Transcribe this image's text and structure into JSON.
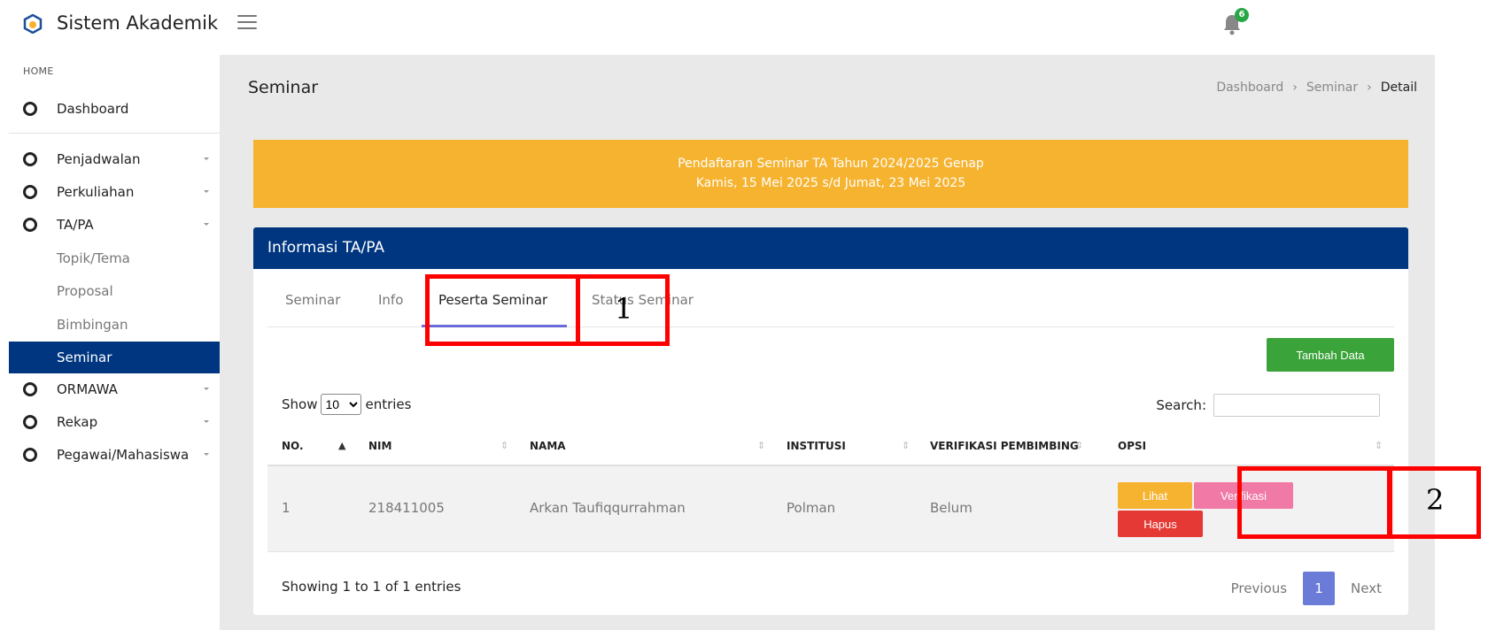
{
  "app": {
    "title": "Sistem Akademik",
    "notification_count": "6"
  },
  "sidebar": {
    "home_label": "HOME",
    "dashboard": "Dashboard",
    "items": [
      {
        "label": "Penjadwalan"
      },
      {
        "label": "Perkuliahan"
      },
      {
        "label": "TA/PA"
      }
    ],
    "subitems": [
      {
        "label": "Topik/Tema"
      },
      {
        "label": "Proposal"
      },
      {
        "label": "Bimbingan"
      },
      {
        "label": "Seminar",
        "active": true
      }
    ],
    "items_after": [
      {
        "label": "ORMAWA"
      },
      {
        "label": "Rekap"
      },
      {
        "label": "Pegawai/Mahasiswa"
      }
    ]
  },
  "page": {
    "title": "Seminar",
    "breadcrumb": [
      "Dashboard",
      "Seminar",
      "Detail"
    ]
  },
  "banner": {
    "line1": "Pendaftaran Seminar TA Tahun 2024/2025 Genap",
    "line2": "Kamis, 15 Mei 2025 s/d Jumat, 23 Mei 2025"
  },
  "card": {
    "title": "Informasi TA/PA",
    "tabs": [
      "Seminar",
      "Info",
      "Peserta Seminar",
      "Status Seminar"
    ],
    "active_tab": "Peserta Seminar",
    "add_button": "Tambah Data",
    "show_label": "Show",
    "entries_label": "entries",
    "page_length": "10",
    "search_label": "Search:",
    "columns": [
      "NO.",
      "NIM",
      "NAMA",
      "INSTITUSI",
      "VERIFIKASI PEMBIMBING",
      "OPSI"
    ],
    "rows": [
      {
        "no": "1",
        "nim": "218411005",
        "nama": "Arkan Taufiqqurrahman",
        "institusi": "Polman",
        "verifikasi": "Belum"
      }
    ],
    "row_actions": {
      "view": "Lihat",
      "verify": "Verifikasi",
      "delete": "Hapus"
    },
    "info": "Showing 1 to 1 of 1 entries",
    "pagination": {
      "previous": "Previous",
      "current": "1",
      "next": "Next"
    }
  },
  "annotations": {
    "label_1": "1",
    "label_2": "2"
  },
  "colors": {
    "primary": "#003680",
    "banner": "#f6b330",
    "add_button": "#3aa33a",
    "view_button": "#f6b330",
    "verify_button": "#f07aa5",
    "delete_button": "#e53935",
    "annotation": "#ff0000"
  }
}
